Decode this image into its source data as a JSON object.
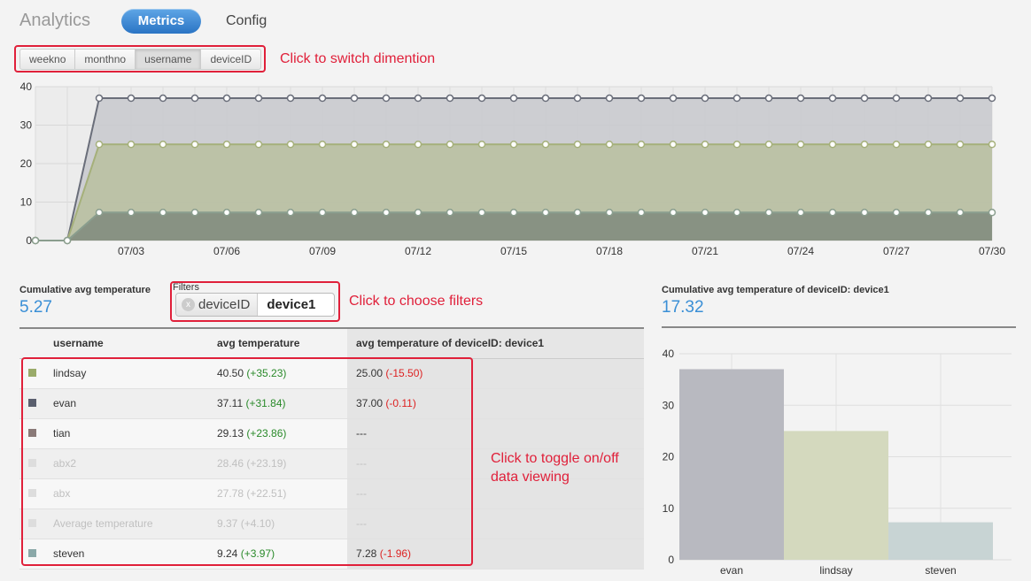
{
  "nav": {
    "brand": "Analytics",
    "tabs": [
      {
        "label": "Metrics",
        "active": true
      },
      {
        "label": "Config",
        "active": false
      }
    ]
  },
  "dimensions": {
    "buttons": [
      "weekno",
      "monthno",
      "username",
      "deviceID"
    ],
    "active": "username"
  },
  "annotations": {
    "switch_dimension": "Click to switch dimention",
    "choose_filters": "Click to choose filters",
    "toggle_line1": "Click to toggle on/off",
    "toggle_line2": "data viewing"
  },
  "summary": {
    "cumulative_label": "Cumulative avg temperature",
    "cumulative_value": "5.27",
    "filtered_label": "Cumulative avg temperature of deviceID: device1",
    "filtered_value": "17.32"
  },
  "filters": {
    "label": "Filters",
    "key": "deviceID",
    "value": "device1",
    "remove_glyph": "x"
  },
  "table": {
    "headers": [
      "username",
      "avg temperature",
      "avg temperature of deviceID: device1"
    ],
    "rows": [
      {
        "name": "lindsay",
        "avg": "40.50",
        "avg_delta": "(+35.23)",
        "dev": "25.00",
        "dev_delta": "(-15.50)",
        "color": "#9aab6a",
        "on": true
      },
      {
        "name": "evan",
        "avg": "37.11",
        "avg_delta": "(+31.84)",
        "dev": "37.00",
        "dev_delta": "(-0.11)",
        "color": "#5a5f6e",
        "on": true
      },
      {
        "name": "tian",
        "avg": "29.13",
        "avg_delta": "(+23.86)",
        "dev": "---",
        "dev_delta": "",
        "color": "#8a7a78",
        "on": true
      },
      {
        "name": "abx2",
        "avg": "28.46",
        "avg_delta": "(+23.19)",
        "dev": "---",
        "dev_delta": "",
        "color": "#dddddd",
        "on": false
      },
      {
        "name": "abx",
        "avg": "27.78",
        "avg_delta": "(+22.51)",
        "dev": "---",
        "dev_delta": "",
        "color": "#dddddd",
        "on": false
      },
      {
        "name": "Average temperature",
        "avg": "9.37",
        "avg_delta": "(+4.10)",
        "dev": "---",
        "dev_delta": "",
        "color": "#dddddd",
        "on": false
      },
      {
        "name": "steven",
        "avg": "9.24",
        "avg_delta": "(+3.97)",
        "dev": "7.28",
        "dev_delta": "(-1.96)",
        "color": "#8aa8a8",
        "on": true
      }
    ]
  },
  "chart_data": [
    {
      "type": "area",
      "x": [
        "06/30",
        "07/01",
        "07/02",
        "07/03",
        "07/04",
        "07/05",
        "07/06",
        "07/07",
        "07/08",
        "07/09",
        "07/10",
        "07/11",
        "07/12",
        "07/13",
        "07/14",
        "07/15",
        "07/16",
        "07/17",
        "07/18",
        "07/19",
        "07/20",
        "07/21",
        "07/22",
        "07/23",
        "07/24",
        "07/25",
        "07/26",
        "07/27",
        "07/28",
        "07/29",
        "07/30"
      ],
      "xticks": [
        "07/03",
        "07/06",
        "07/09",
        "07/12",
        "07/15",
        "07/18",
        "07/21",
        "07/24",
        "07/27",
        "07/30"
      ],
      "ylim": [
        0,
        40
      ],
      "yticks": [
        0,
        10,
        20,
        30,
        40
      ],
      "grid": true,
      "series": [
        {
          "color": "#6a6e7a",
          "fill": "#c8c9ce",
          "level": 37
        },
        {
          "color": "#a5b07a",
          "fill": "#b9c0a0",
          "level": 25
        },
        {
          "color": "#8a9e8e",
          "fill": "#7f8a7c",
          "level": 7.3
        }
      ]
    },
    {
      "type": "bar",
      "categories": [
        "evan",
        "lindsay",
        "steven"
      ],
      "values": [
        37,
        25,
        7.28
      ],
      "colors": [
        "#b8b9c0",
        "#d4d9be",
        "#c8d4d4"
      ],
      "ylim": [
        0,
        40
      ],
      "yticks": [
        0,
        10,
        20,
        30,
        40
      ],
      "grid": true
    }
  ]
}
